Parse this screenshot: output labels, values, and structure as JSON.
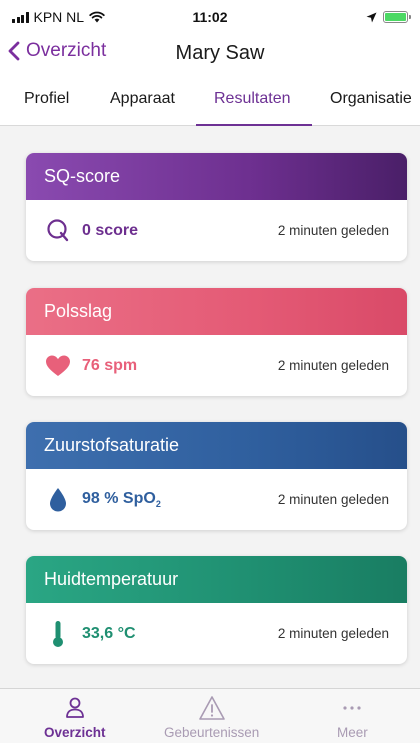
{
  "status_bar": {
    "carrier": "KPN NL",
    "time": "11:02"
  },
  "nav": {
    "back_label": "Overzicht",
    "title": "Mary Saw"
  },
  "tabs": [
    {
      "label": "Profiel"
    },
    {
      "label": "Apparaat"
    },
    {
      "label": "Resultaten",
      "active": true
    },
    {
      "label": "Organisatie"
    }
  ],
  "cards": [
    {
      "title": "SQ-score",
      "value": "0 score",
      "time": "2 minuten geleden",
      "icon": "q-icon",
      "color": "#6d2f8f"
    },
    {
      "title": "Polsslag",
      "value": "76 spm",
      "time": "2 minuten geleden",
      "icon": "heart-icon",
      "color": "#e8607a"
    },
    {
      "title": "Zuurstofsaturatie",
      "value": "98 % SpO",
      "value_sub": "2",
      "time": "2 minuten geleden",
      "icon": "drop-icon",
      "color": "#2f5f9e"
    },
    {
      "title": "Huidtemperatuur",
      "value": "33,6 °C",
      "time": "2 minuten geleden",
      "icon": "thermometer-icon",
      "color": "#1f8f71"
    }
  ],
  "tab_bar": [
    {
      "label": "Overzicht",
      "icon": "person-icon",
      "active": true
    },
    {
      "label": "Gebeurtenissen",
      "icon": "warning-icon"
    },
    {
      "label": "Meer",
      "icon": "more-icon"
    }
  ],
  "colors": {
    "accent": "#6d3194",
    "tab_bar_inactive": "#a99bb3"
  }
}
